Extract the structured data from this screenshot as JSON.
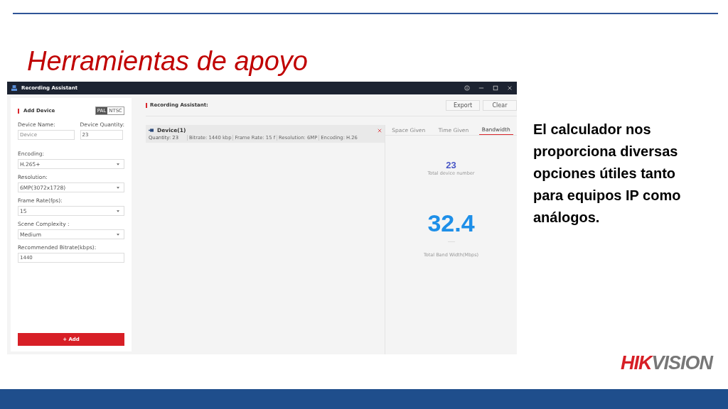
{
  "slide": {
    "title": "Herramientas de apoyo",
    "body": "El calculador nos proporciona diversas opciones útiles tanto para equipos IP como análogos."
  },
  "window": {
    "title": "Recording Assistant"
  },
  "add_device": {
    "heading": "Add Device",
    "standards": [
      {
        "label": "PAL",
        "selected": true
      },
      {
        "label": "NTSC",
        "selected": false
      }
    ],
    "device_name": {
      "label": "Device Name:",
      "placeholder": "Device"
    },
    "device_quantity": {
      "label": "Device Quantity:",
      "value": "23"
    },
    "dropdowns": [
      {
        "label": "Encoding:",
        "value": "H.265+"
      },
      {
        "label": "Resolution:",
        "value": "6MP(3072x1728)"
      },
      {
        "label": "Frame Rate(fps):",
        "value": "15"
      },
      {
        "label": "Scene Complexity :",
        "value": "Medium"
      }
    ],
    "bitrate": {
      "label": "Recommended Bitrate(kbps):",
      "value": "1440"
    },
    "add_button": "+ Add"
  },
  "assistant": {
    "heading": "Recording Assistant:",
    "buttons": [
      "Export",
      "Clear"
    ],
    "device": {
      "name": "Device(1)",
      "fields": [
        "Quantity: 23",
        "Bitrate: 1440 kbp",
        "Frame Rate: 15 f",
        "Resolution: 6MP",
        "Encoding: H.26"
      ]
    },
    "tabs": [
      {
        "label": "Space Given",
        "selected": false
      },
      {
        "label": "Time Given",
        "selected": false
      },
      {
        "label": "Bandwidth",
        "selected": true
      }
    ],
    "device_count": "23",
    "device_count_label": "Total device number",
    "bandwidth": "32.4",
    "bandwidth_label": "Total Band Width(Mbps)"
  },
  "logo": {
    "part_1": "HIK",
    "part_2": "VISION"
  }
}
